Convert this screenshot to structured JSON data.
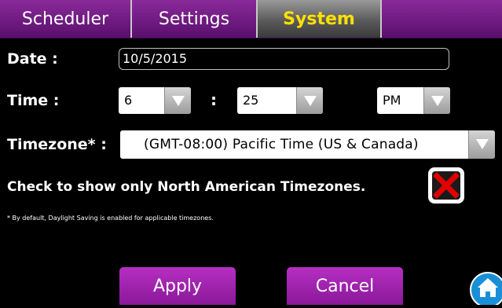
{
  "tabs": {
    "scheduler": "Scheduler",
    "settings": "Settings",
    "system": "System",
    "active": "System"
  },
  "form": {
    "date_label": "Date :",
    "date_value": "10/5/2015",
    "time_label": "Time :",
    "hour_value": "6",
    "time_separator": ":",
    "minute_value": "25",
    "ampm_value": "PM",
    "timezone_label": "Timezone* :",
    "timezone_value": "(GMT-08:00) Pacific Time (US & Canada)",
    "checkbox_label": "Check to show only North American Timezones.",
    "checkbox_checked": false,
    "footnote": "* By default, Daylight Saving is enabled for applicable timezones."
  },
  "buttons": {
    "apply": "Apply",
    "cancel": "Cancel"
  },
  "icons": {
    "dropdown": "chevron-down-icon",
    "checkbox_mark": "x-mark-icon",
    "home": "home-icon"
  },
  "colors": {
    "purple_accent": "#8a189a",
    "active_tab_text": "#ffe100",
    "checkbox_x": "#e00000",
    "home_blue": "#1a8fd8"
  }
}
